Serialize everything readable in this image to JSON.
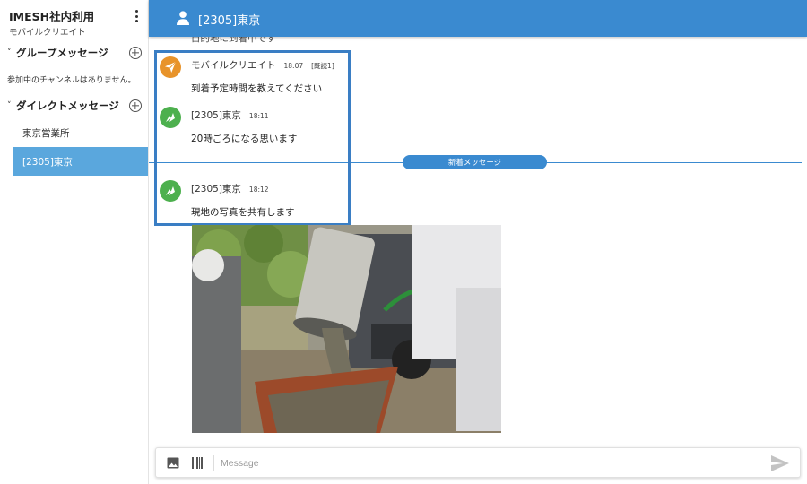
{
  "sidebar": {
    "app_title": "IMESH社内利用",
    "org_name": "モバイルクリエイト",
    "menu_icon": "more-vert-icon",
    "group_section": {
      "label": "グループメッセージ",
      "empty_text": "参加中のチャンネルはありません。"
    },
    "direct_section": {
      "label": "ダイレクトメッセージ"
    },
    "dm_items": [
      {
        "label": "東京営業所",
        "active": false
      },
      {
        "label": "[2305]東京",
        "active": true
      }
    ]
  },
  "header": {
    "title": "[2305]東京",
    "icon": "person-icon"
  },
  "chat": {
    "truncated_previous": "目的地に到着中です",
    "messages": [
      {
        "sender": "モバイルクリエイト",
        "time": "18:07",
        "read": "[既読1]",
        "text": "到着予定時間を教えてください",
        "avatar": "send-icon",
        "avatar_color": "#e8932a"
      },
      {
        "sender": "[2305]東京",
        "time": "18:11",
        "read": "",
        "text": "20時ごろになる思います",
        "avatar": "logo-icon",
        "avatar_color": "#4db04e"
      },
      {
        "sender": "[2305]東京",
        "time": "18:12",
        "read": "",
        "text": "現地の写真を共有します",
        "avatar": "logo-icon",
        "avatar_color": "#4db04e"
      }
    ],
    "new_messages_label": "新着メッセージ",
    "attachment": "photo-attachment"
  },
  "composer": {
    "placeholder": "Message",
    "value": "",
    "image_icon": "image-icon",
    "barcode_icon": "barcode-icon",
    "send_icon": "send-icon"
  },
  "colors": {
    "primary": "#3a8ad0",
    "active_item": "#5aa7dd",
    "highlight_border": "#3a7ec4",
    "orange": "#e8932a",
    "green": "#4db04e"
  }
}
